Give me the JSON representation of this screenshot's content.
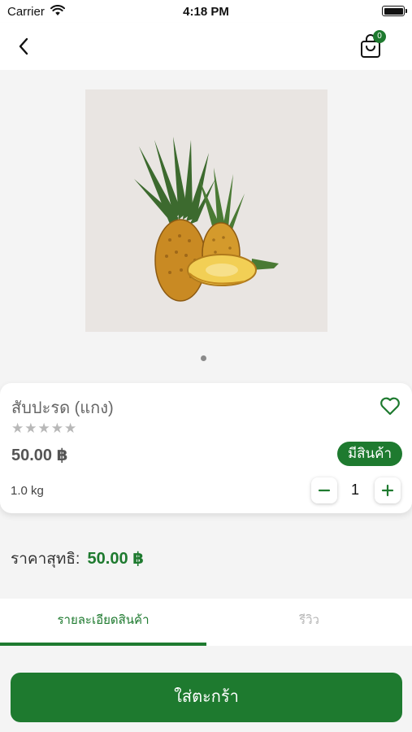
{
  "status_bar": {
    "carrier": "Carrier",
    "time": "4:18 PM"
  },
  "nav": {
    "back_icon": "chevron-left-icon",
    "cart_icon": "shopping-bag-icon",
    "cart_count": "0"
  },
  "product": {
    "image": "pineapple-photo",
    "name": "สับปะรด (แกง)",
    "stars": "★★★★★",
    "rating": 0,
    "price": "50.00 ฿",
    "stock_label": "มีสินค้า",
    "weight": "1.0 kg",
    "quantity": "1"
  },
  "net_price": {
    "label": "ราคาสุทธิ:",
    "value": "50.00 ฿"
  },
  "tabs": {
    "items": [
      {
        "label": "รายละเอียดสินค้า",
        "active": true
      },
      {
        "label": "รีวิว",
        "active": false
      }
    ]
  },
  "add_to_cart_label": "ใส่ตะกร้า",
  "colors": {
    "accent": "#1e7a2f",
    "star_inactive": "#b8b8b8"
  }
}
